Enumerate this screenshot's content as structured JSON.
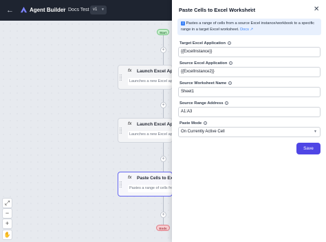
{
  "topbar": {
    "back_icon": "arrow-left-icon",
    "brand": "Agent Builder",
    "separator": "/",
    "project": "Docs Test",
    "version": "v1"
  },
  "canvas": {
    "start_label": "Start",
    "end_label": "Ends",
    "nodes": [
      {
        "title": "Launch Excel Application",
        "description": "Launches a new Excel application",
        "icon": "fx-function-icon"
      },
      {
        "title": "Launch Excel Application",
        "description": "Launches a new Excel application",
        "icon": "fx-function-icon"
      },
      {
        "title": "Paste Cells to Excel Worksheet",
        "description": "Pastes a range of cells from a source",
        "icon": "fx-function-icon"
      }
    ],
    "controls": {
      "fit": "⤢",
      "zoom_out": "−",
      "zoom_in": "+",
      "pan": "✋"
    }
  },
  "panel": {
    "title": "Paste Cells to Excel Worksheet",
    "info_text": "Pastes a range of cells from a source Excel instance/workbook to a specific range in a target Excel worksheet.",
    "docs_link": "Docs",
    "fields": [
      {
        "label": "Target Excel Application",
        "value": "{{ExcelInstance}}"
      },
      {
        "label": "Source Excel Application",
        "value": "{{ExcelInstance2}}"
      },
      {
        "label": "Source Worksheet Name",
        "value": "Sheet1"
      },
      {
        "label": "Source Range Address",
        "value": "A1:A3"
      },
      {
        "label": "Paste Mode",
        "value": "On Currently Active Cell"
      }
    ],
    "save_label": "Save"
  },
  "colors": {
    "accent": "#4f46e5",
    "topbar": "#1e2430",
    "info_bg": "#e8f0fd",
    "link": "#3b82f6"
  }
}
